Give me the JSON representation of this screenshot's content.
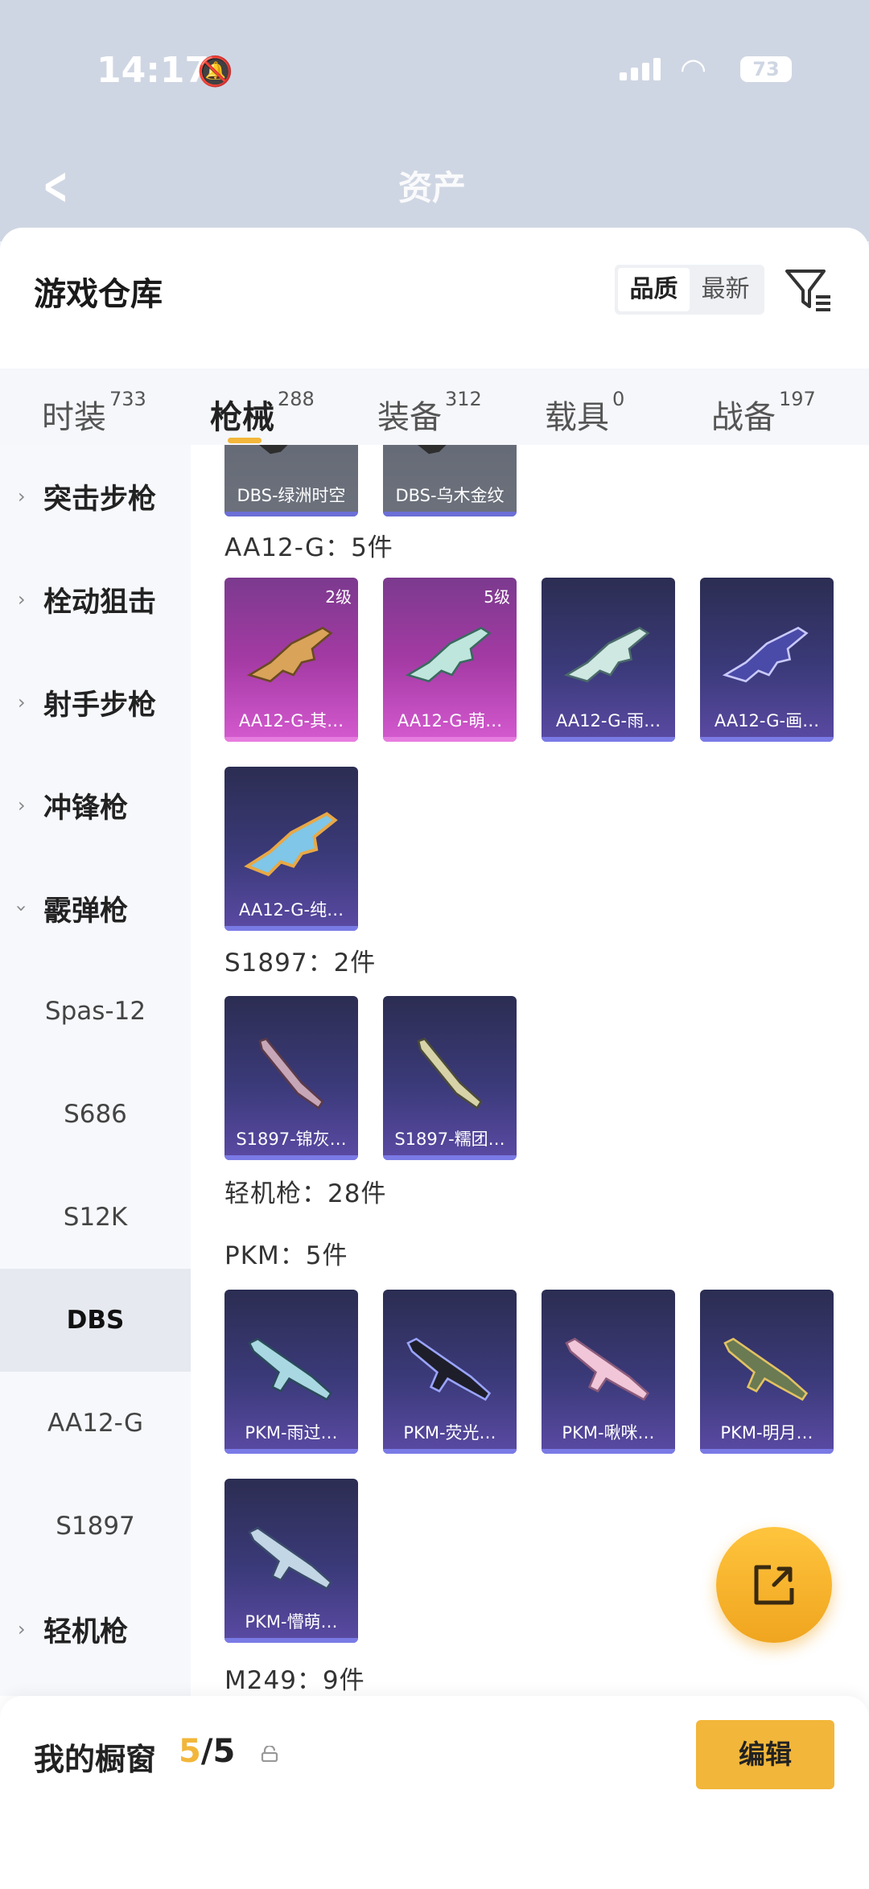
{
  "status_bar": {
    "time": "14:17",
    "battery": "73"
  },
  "background": {
    "title": "资产"
  },
  "sheet": {
    "title": "游戏仓库",
    "sort": {
      "quality": "品质",
      "newest": "最新",
      "selected": "品质"
    }
  },
  "tabs": [
    {
      "label": "时装",
      "count": "733"
    },
    {
      "label": "枪械",
      "count": "288",
      "active": true
    },
    {
      "label": "装备",
      "count": "312"
    },
    {
      "label": "载具",
      "count": "0"
    },
    {
      "label": "战备",
      "count": "197"
    }
  ],
  "sidebar": [
    {
      "label": "突击步枪",
      "type": "category"
    },
    {
      "label": "栓动狙击",
      "type": "category"
    },
    {
      "label": "射手步枪",
      "type": "category"
    },
    {
      "label": "冲锋枪",
      "type": "category"
    },
    {
      "label": "霰弹枪",
      "type": "category",
      "expanded": true
    },
    {
      "label": "Spas-12",
      "type": "sub"
    },
    {
      "label": "S686",
      "type": "sub"
    },
    {
      "label": "S12K",
      "type": "sub"
    },
    {
      "label": "DBS",
      "type": "sub",
      "selected": true
    },
    {
      "label": "AA12-G",
      "type": "sub"
    },
    {
      "label": "S1897",
      "type": "sub"
    },
    {
      "label": "轻机枪",
      "type": "category"
    }
  ],
  "content": {
    "top_cards": [
      {
        "name": "DBS-绿洲时空"
      },
      {
        "name": "DBS-乌木金纹"
      }
    ],
    "groups": {
      "aa12": {
        "heading": "AA12-G：5件",
        "cards": [
          {
            "name": "AA12-G-其…",
            "level": "2级",
            "rarity": "pink"
          },
          {
            "name": "AA12-G-萌…",
            "level": "5级",
            "rarity": "pink"
          },
          {
            "name": "AA12-G-雨…",
            "rarity": "purple"
          },
          {
            "name": "AA12-G-画…",
            "rarity": "purple"
          },
          {
            "name": "AA12-G-纯…",
            "rarity": "purple"
          }
        ]
      },
      "s1897": {
        "heading": "S1897：2件",
        "cards": [
          {
            "name": "S1897-锦灰…",
            "rarity": "purple"
          },
          {
            "name": "S1897-糯团…",
            "rarity": "purple"
          }
        ]
      },
      "lmg": {
        "heading": "轻机枪：28件"
      },
      "pkm": {
        "heading": "PKM：5件",
        "cards": [
          {
            "name": "PKM-雨过…",
            "rarity": "purple"
          },
          {
            "name": "PKM-荧光…",
            "rarity": "purple"
          },
          {
            "name": "PKM-啾咪…",
            "rarity": "purple"
          },
          {
            "name": "PKM-明月…",
            "rarity": "purple"
          },
          {
            "name": "PKM-懵萌…",
            "rarity": "purple"
          }
        ]
      },
      "m249": {
        "heading": "M249：9件"
      }
    }
  },
  "showcase": {
    "label": "我的橱窗",
    "used": "5",
    "total": "/5",
    "edit": "编辑"
  },
  "icons": {
    "fab": "share-export-icon",
    "filter": "filter-icon",
    "lock": "lock-icon",
    "back": "back-arrow-icon"
  },
  "colors": {
    "accent": "#f2b63a",
    "purple_card": "#3b3a7a",
    "pink_card": "#a43aa4"
  }
}
